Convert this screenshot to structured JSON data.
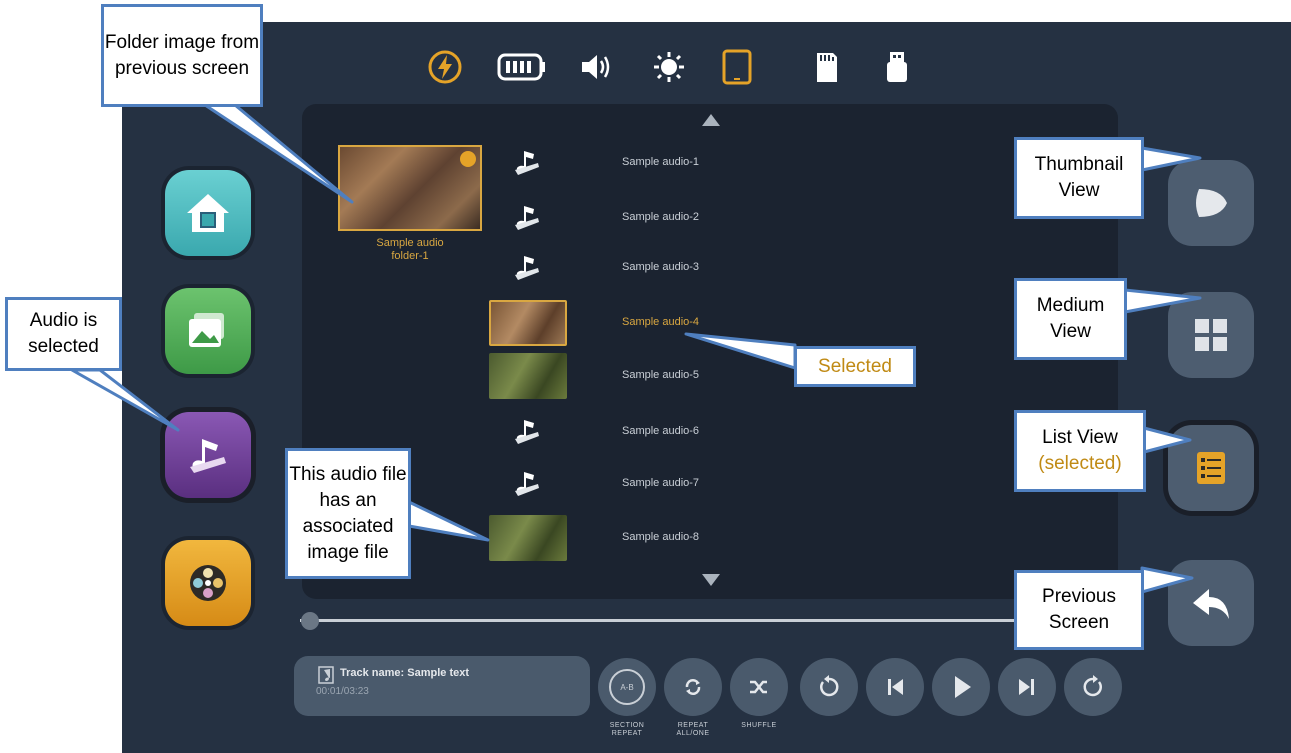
{
  "folder": {
    "label_line1": "Sample audio",
    "label_line2": "folder-1"
  },
  "tracks": [
    {
      "name": "Sample audio-1"
    },
    {
      "name": "Sample audio-2"
    },
    {
      "name": "Sample audio-3"
    },
    {
      "name": "Sample audio-4"
    },
    {
      "name": "Sample audio-5"
    },
    {
      "name": "Sample audio-6"
    },
    {
      "name": "Sample audio-7"
    },
    {
      "name": "Sample audio-8"
    }
  ],
  "player": {
    "track_name": "Track name: Sample text",
    "time": "00:01/03:23",
    "section_repeat_label": "SECTION REPEAT",
    "section_repeat_icon_text": "A-B",
    "repeat_label": "REPEAT ALL/ONE",
    "shuffle_label": "SHUFFLE"
  },
  "callouts": {
    "folder_image": "Folder image from previous screen",
    "audio_selected": "Audio is selected",
    "associated_image": "This audio file has an associated image file",
    "selected": "Selected",
    "thumbnail_view": "Thumbnail View",
    "medium_view": "Medium View",
    "list_view": "List View",
    "list_view_selected": "(selected)",
    "previous_screen": "Previous Screen"
  },
  "status_icons": [
    "charging-icon",
    "battery-icon",
    "volume-icon",
    "brightness-icon",
    "tablet-icon",
    "sd-card-icon",
    "usb-icon"
  ],
  "colors": {
    "background": "#253142",
    "panel": "#1b2330",
    "accent_gold": "#d9a741",
    "callout_border": "#4f7fbf",
    "home_button": "#4fb9bf",
    "image_button": "#4aa553",
    "audio_button": "#6a3f8f",
    "video_button": "#e5a328"
  }
}
